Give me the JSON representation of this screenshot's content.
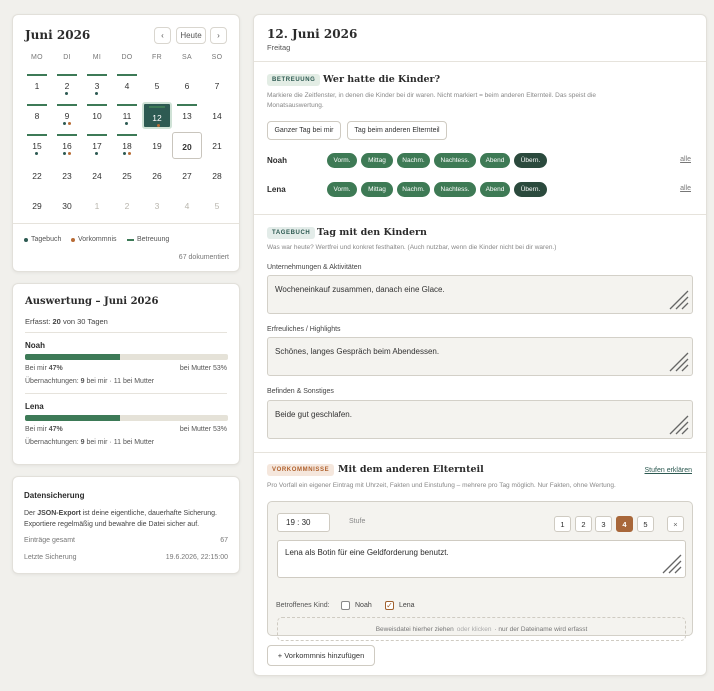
{
  "calendar": {
    "title": "Juni 2026",
    "prev": "‹",
    "today_btn": "Heute",
    "next": "›",
    "dow": [
      "MO",
      "DI",
      "MI",
      "DO",
      "FR",
      "SA",
      "SO"
    ],
    "days": [
      "1",
      "2",
      "3",
      "4",
      "5",
      "6",
      "7",
      "8",
      "9",
      "10",
      "11",
      "12",
      "13",
      "14",
      "15",
      "16",
      "17",
      "18",
      "19",
      "20",
      "21",
      "22",
      "23",
      "24",
      "25",
      "26",
      "27",
      "28",
      "29",
      "30",
      "1",
      "2",
      "3",
      "4",
      "5"
    ],
    "legend": {
      "tagebuch": "Tagebuch",
      "vorkommnis": "Vorkommnis",
      "betreuung": "Betreuung"
    },
    "documented": "67 dokumentiert",
    "colors": {
      "tagebuch": "#2d5a52",
      "vorkommnis": "#b86b35",
      "betreuung": "#3d7a57",
      "selected": "#2d5a52"
    }
  },
  "stats": {
    "title": "Auswertung – Juni 2026",
    "captured_prefix": "Erfasst: ",
    "captured_value": "20",
    "captured_suffix": " von 30 Tagen",
    "children": [
      {
        "name": "Noah",
        "share_me": 0.47,
        "me_prefix": "Bei mir ",
        "me_value": "47%",
        "mother": "bei Mutter 53%",
        "nights_prefix": "Übernachtungen: ",
        "nights_value": "9",
        "nights_suffix": " bei mir · 11 bei Mutter"
      },
      {
        "name": "Lena",
        "share_me": 0.47,
        "me_prefix": "Bei mir ",
        "me_value": "47%",
        "mother": "bei Mutter 53%",
        "nights_prefix": "Übernachtungen: ",
        "nights_value": "9",
        "nights_suffix": " bei mir · 11 bei Mutter"
      }
    ]
  },
  "backup": {
    "title": "Datensicherung",
    "text_a": "Der ",
    "text_b": "JSON-Export",
    "text_c": " ist deine eigentliche, dauerhafte Sicherung.",
    "text_d": "Exportiere regelmäßig und bewahre die Datei sicher auf.",
    "entries_label": "Einträge gesamt",
    "entries_value": "67",
    "last_label": "Letzte Sicherung",
    "last_value": "19.6.2026, 22:15:00"
  },
  "day": {
    "date": "12. Juni 2026",
    "weekday": "Freitag"
  },
  "care": {
    "tag": "BETREUUNG",
    "title": "Wer hatte die Kinder?",
    "desc1": "Markiere die Zeitfenster, in denen die Kinder bei dir waren. Nicht markiert = beim anderen Elternteil. Das speist die",
    "desc2": "Monatsauswertung.",
    "btn_all_me": "Ganzer Tag bei mir",
    "btn_all_other": "Tag beim anderen Elternteil",
    "slots": [
      "Vorm.",
      "Mittag",
      "Nachm.",
      "Nachtess.",
      "Abend",
      "Übern."
    ],
    "children": [
      {
        "name": "Noah",
        "alle": "alle"
      },
      {
        "name": "Lena",
        "alle": "alle"
      }
    ]
  },
  "diary": {
    "tag": "TAGEBUCH",
    "title": "Tag mit den Kindern",
    "desc": "Was war heute? Wertfrei und konkret festhalten. (Auch nutzbar, wenn die Kinder nicht bei dir waren.)",
    "f1_label": "Unternehmungen & Aktivitäten",
    "f1_value": "Wocheneinkauf zusammen, danach eine Glace.",
    "f2_label": "Erfreuliches / Highlights",
    "f2_value": "Schönes, langes Gespräch beim Abendessen.",
    "f3_label": "Befinden & Sonstiges",
    "f3_value": "Beide gut geschlafen."
  },
  "incident": {
    "tag": "VORKOMMNISSE",
    "title": "Mit dem anderen Elternteil",
    "explain": "Stufen erklären",
    "desc": "Pro Vorfall ein eigener Eintrag mit Uhrzeit, Fakten und Einstufung – mehrere pro Tag möglich. Nur Fakten, ohne Wertung.",
    "time": "19 : 30",
    "level_label": "Stufe",
    "levels": [
      "1",
      "2",
      "3",
      "4",
      "5"
    ],
    "selected_level": "4",
    "remove": "×",
    "text": "Lena als Botin für eine Geldforderung benutzt.",
    "affected_label": "Betroffenes Kind:",
    "child1": "Noah",
    "child2": "Lena",
    "drop_a": "Beweisdatei hierher ziehen",
    "drop_b": "oder klicken",
    "drop_c": "· nur der Dateiname wird erfasst",
    "add": "+ Vorkommnis hinzufügen"
  }
}
